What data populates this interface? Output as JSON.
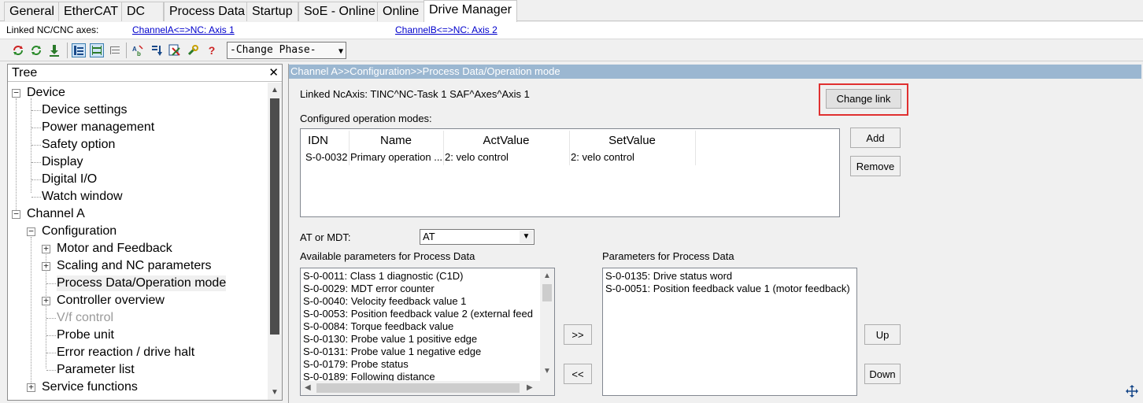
{
  "tabs": [
    {
      "label": "General"
    },
    {
      "label": "EtherCAT"
    },
    {
      "label": "DC"
    },
    {
      "label": "Process Data"
    },
    {
      "label": "Startup"
    },
    {
      "label": "SoE - Online"
    },
    {
      "label": "Online"
    },
    {
      "label": "Drive Manager",
      "active": true
    }
  ],
  "linked_axes": {
    "label": "Linked NC/CNC axes:",
    "channel_a": "ChannelA<=>NC: Axis 1",
    "channel_b": "ChannelB<=>NC: Axis 2"
  },
  "toolbar": {
    "icons": [
      "refresh-red-icon",
      "refresh-green-icon",
      "download-icon",
      "tree-view-icon",
      "list-view-icon",
      "structure-view-icon",
      "rename-icon",
      "sort-icon",
      "export-icon",
      "tools-icon",
      "help-icon"
    ],
    "help_glyph": "?",
    "phase_select": "-Change Phase-"
  },
  "tree": {
    "title": "Tree",
    "items": [
      {
        "label": "Device"
      },
      {
        "label": "Device settings"
      },
      {
        "label": "Power management"
      },
      {
        "label": "Safety option"
      },
      {
        "label": "Display"
      },
      {
        "label": "Digital I/O"
      },
      {
        "label": "Watch window"
      },
      {
        "label": "Channel A"
      },
      {
        "label": "Configuration"
      },
      {
        "label": "Motor and Feedback"
      },
      {
        "label": "Scaling and NC parameters"
      },
      {
        "label": "Process Data/Operation mode",
        "selected": true
      },
      {
        "label": "Controller overview"
      },
      {
        "label": "V/f control",
        "disabled": true
      },
      {
        "label": "Probe unit"
      },
      {
        "label": "Error reaction / drive halt"
      },
      {
        "label": "Parameter list"
      },
      {
        "label": "Service functions"
      }
    ]
  },
  "breadcrumb": "Channel A>>Configuration>>Process Data/Operation mode",
  "linked_ncaxis": "Linked NcAxis: TINC^NC-Task 1 SAF^Axes^Axis 1",
  "buttons": {
    "change_link": "Change link",
    "add": "Add",
    "remove": "Remove",
    "to_right": ">>",
    "to_left": "<<",
    "up": "Up",
    "down": "Down"
  },
  "op_modes": {
    "label": "Configured operation modes:",
    "columns": [
      "IDN",
      "Name",
      "ActValue",
      "SetValue"
    ],
    "rows": [
      {
        "idn": "S-0-0032",
        "name": "Primary operation ...",
        "act": "2: velo control",
        "set": "2: velo control"
      }
    ]
  },
  "at_mdt": {
    "label": "AT or MDT:",
    "value": "AT"
  },
  "available": {
    "label": "Available parameters for Process Data",
    "items": [
      "S-0-0011: Class 1 diagnostic (C1D)",
      "S-0-0029: MDT error counter",
      "S-0-0040: Velocity feedback value 1",
      "S-0-0053: Position feedback value 2 (external feed",
      "S-0-0084: Torque feedback value",
      "S-0-0130: Probe value 1 positive edge",
      "S-0-0131: Probe value 1 negative edge",
      "S-0-0179: Probe status",
      "S-0-0189: Following distance"
    ]
  },
  "selected": {
    "label": "Parameters for Process Data",
    "items": [
      "S-0-0135: Drive status word",
      "S-0-0051: Position feedback value 1 (motor feedback)"
    ]
  }
}
